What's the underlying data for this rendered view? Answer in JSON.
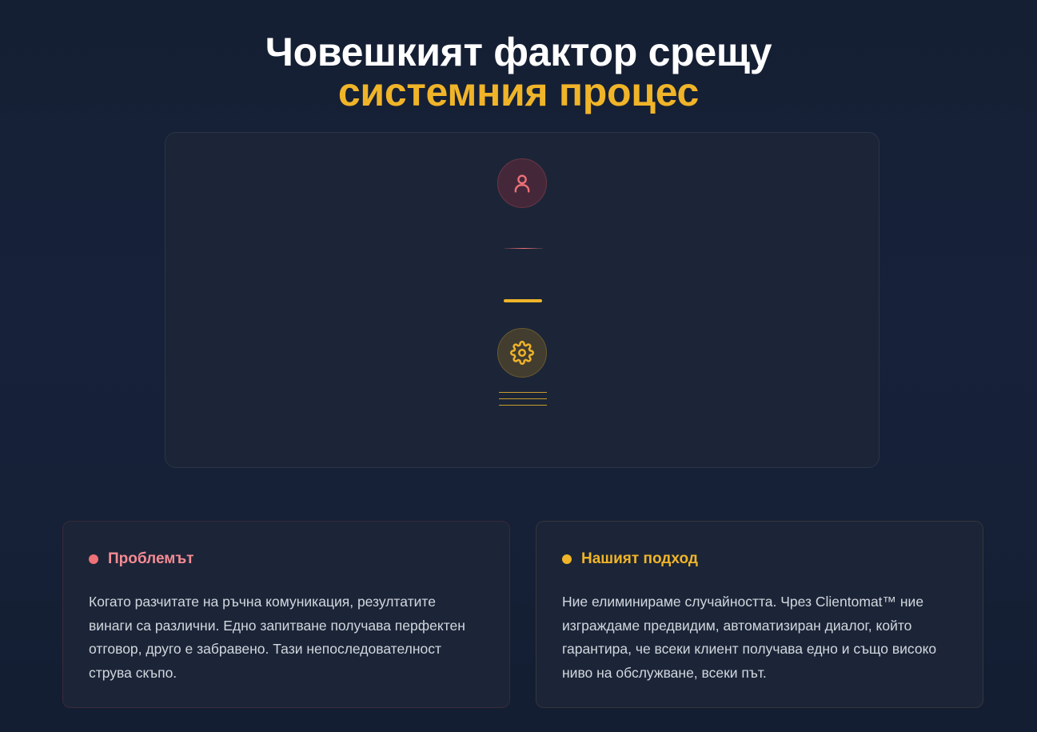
{
  "headline": {
    "line1": "Човешкият фактор срещу",
    "line2": "системния процес"
  },
  "diagram": {
    "top_icon": "user-icon",
    "bottom_icon": "gear-icon",
    "colors": {
      "human": "#f07178",
      "system": "#f0b429"
    }
  },
  "problem": {
    "title": "Проблемът",
    "body": "Когато разчитате на ръчна комуникация, резултатите винаги са различни. Едно запитване получава перфектен отговор, друго е забравено. Тази непоследователност струва скъпо."
  },
  "approach": {
    "title": "Нашият подход",
    "body": "Ние елиминираме случайността. Чрез Clientomat™ ние изграждаме предвидим, автоматизиран диалог, който гарантира, че всеки клиент получава едно и също високо ниво на обслужване, всеки път."
  }
}
